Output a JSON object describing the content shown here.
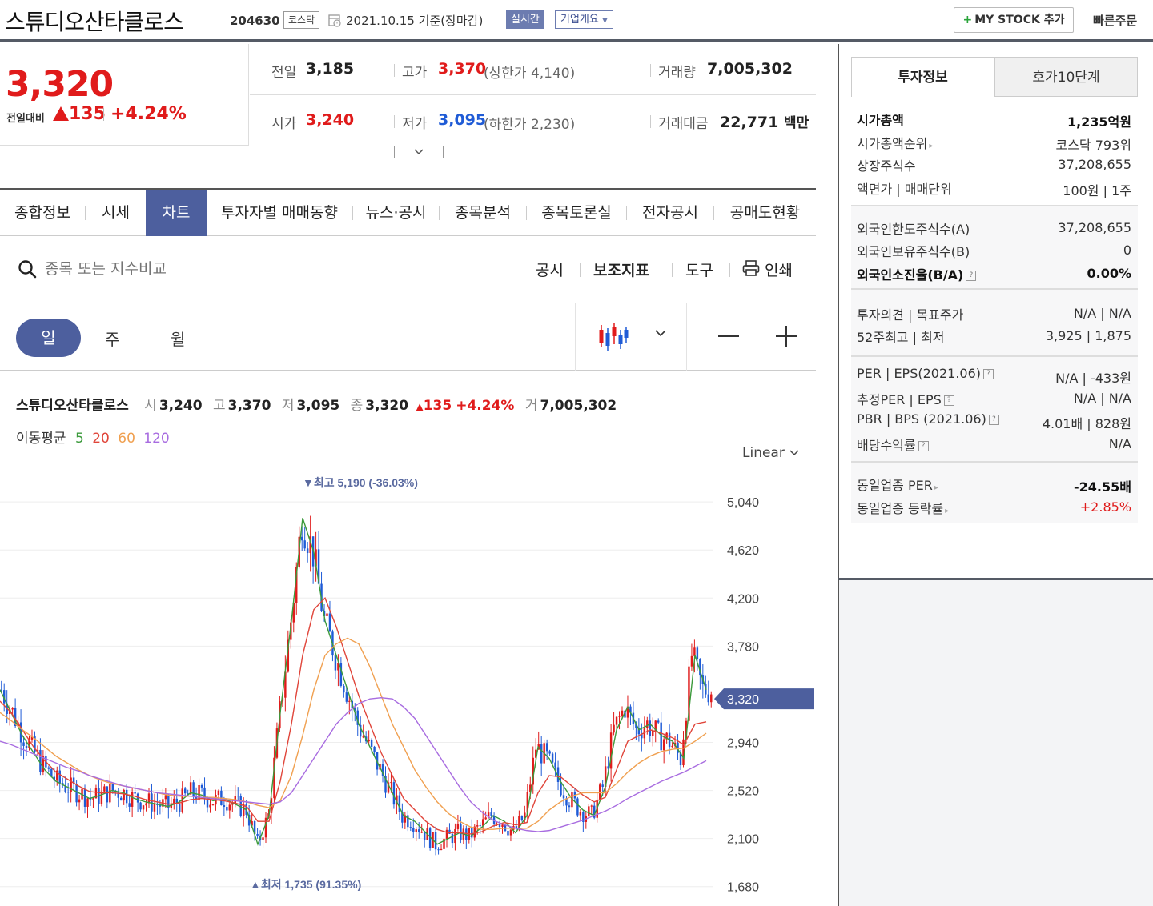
{
  "header": {
    "stock_name": "스튜디오산타클로스",
    "stock_code": "204630",
    "market": "코스닥",
    "date": "2021.10.15  기준(장마감)",
    "realtime_badge": "실시간",
    "corp_overview": "기업개요",
    "mystock_label": "MY STOCK 추가",
    "quick_order": "빠른주문"
  },
  "price": {
    "current": "3,320",
    "change_label": "전일대비",
    "change": "135",
    "change_pct": "+4.24%"
  },
  "quote": {
    "prev_label": "전일",
    "prev": "3,185",
    "high_label": "고가",
    "high": "3,370",
    "upper_limit": "(상한가 4,140)",
    "volume_label": "거래량",
    "volume": "7,005,302",
    "open_label": "시가",
    "open": "3,240",
    "low_label": "저가",
    "low": "3,095",
    "lower_limit": "(하한가 2,230)",
    "amount_label": "거래대금",
    "amount": "22,771",
    "amount_unit": "백만"
  },
  "tabs": [
    "종합정보",
    "시세",
    "차트",
    "투자자별 매매동향",
    "뉴스·공시",
    "종목분석",
    "종목토론실",
    "전자공시",
    "공매도현황"
  ],
  "active_tab": "차트",
  "chart_toolbar": {
    "search_placeholder": "종목 또는 지수비교",
    "disclosure": "공시",
    "indicators": "보조지표",
    "tools": "도구",
    "print": "인쇄",
    "periods": [
      "일",
      "주",
      "월"
    ]
  },
  "chart_info": {
    "name": "스튜디오산타클로스",
    "open_label": "시",
    "open": "3,240",
    "high_label": "고",
    "high": "3,370",
    "low_label": "저",
    "low": "3,095",
    "close_label": "종",
    "close": "3,320",
    "change": "135",
    "change_pct": "+4.24%",
    "volume_label": "거",
    "volume": "7,005,302",
    "ma_label": "이동평균",
    "ma_periods": [
      "5",
      "20",
      "60",
      "120"
    ],
    "scale": "Linear"
  },
  "colors": {
    "up": "#e01b1b",
    "down": "#1f5bd6",
    "accent": "#4d5f9e",
    "ma5": "#3c9a3c",
    "ma20": "#e0453a",
    "ma60": "#f0a050",
    "ma120": "#a86ce0"
  },
  "chart_data": {
    "type": "line",
    "title": "",
    "xlabel": "",
    "ylabel": "",
    "y_ticks": [
      1680,
      2100,
      2520,
      2940,
      3320,
      3780,
      4200,
      4620,
      5040
    ],
    "y_tick_labels": [
      "1,680",
      "2,100",
      "2,520",
      "2,940",
      "3,320",
      "3,780",
      "4,200",
      "4,620",
      "5,040"
    ],
    "ylim": [
      1580,
      5300
    ],
    "current_label": "3,320",
    "high_annotation": "최고 5,190 (-36.03%)",
    "low_annotation": "최저 1,735 (91.35%)",
    "series": [
      {
        "name": "5",
        "values": [
          3400,
          3200,
          3000,
          2850,
          2700,
          2600,
          2550,
          2500,
          2450,
          2480,
          2520,
          2500,
          2450,
          2420,
          2400,
          2380,
          2420,
          2500,
          2480,
          2430,
          2450,
          2400,
          2350,
          2050,
          2300,
          3200,
          4000,
          4900,
          4600,
          4000,
          3700,
          3400,
          3100,
          2900,
          2700,
          2500,
          2300,
          2250,
          2150,
          2050,
          2100,
          2150,
          2120,
          2200,
          2300,
          2250,
          2150,
          2300,
          2900,
          2800,
          2600,
          2450,
          2350,
          2300,
          2550,
          3050,
          3250,
          3050,
          3100,
          3000,
          2950,
          2800,
          3700,
          3400
        ]
      },
      {
        "name": "20",
        "values": [
          3300,
          3200,
          3050,
          2900,
          2780,
          2680,
          2620,
          2560,
          2510,
          2500,
          2500,
          2490,
          2470,
          2440,
          2420,
          2400,
          2410,
          2440,
          2450,
          2440,
          2430,
          2410,
          2380,
          2250,
          2250,
          2600,
          3100,
          3700,
          4100,
          4200,
          3950,
          3650,
          3350,
          3100,
          2850,
          2650,
          2450,
          2350,
          2250,
          2180,
          2150,
          2150,
          2140,
          2160,
          2210,
          2240,
          2220,
          2240,
          2500,
          2650,
          2640,
          2560,
          2480,
          2420,
          2460,
          2700,
          2950,
          3000,
          3050,
          3020,
          2980,
          2920,
          3100,
          3120
        ]
      },
      {
        "name": "60",
        "values": [
          3200,
          3130,
          3050,
          2980,
          2900,
          2820,
          2760,
          2700,
          2650,
          2610,
          2580,
          2560,
          2540,
          2520,
          2500,
          2480,
          2470,
          2470,
          2460,
          2460,
          2450,
          2440,
          2420,
          2390,
          2370,
          2430,
          2650,
          3000,
          3400,
          3700,
          3800,
          3850,
          3800,
          3600,
          3350,
          3100,
          2900,
          2700,
          2550,
          2420,
          2320,
          2250,
          2200,
          2180,
          2180,
          2190,
          2190,
          2190,
          2250,
          2350,
          2420,
          2470,
          2500,
          2500,
          2500,
          2580,
          2680,
          2760,
          2820,
          2860,
          2880,
          2890,
          2950,
          3020
        ]
      },
      {
        "name": "120",
        "values": [
          2950,
          2920,
          2880,
          2840,
          2800,
          2760,
          2720,
          2690,
          2650,
          2620,
          2590,
          2560,
          2540,
          2520,
          2500,
          2490,
          2480,
          2470,
          2460,
          2450,
          2440,
          2430,
          2420,
          2410,
          2400,
          2420,
          2500,
          2650,
          2800,
          2950,
          3100,
          3200,
          3280,
          3320,
          3330,
          3320,
          3250,
          3150,
          3000,
          2850,
          2700,
          2550,
          2420,
          2330,
          2260,
          2220,
          2190,
          2170,
          2160,
          2170,
          2200,
          2230,
          2260,
          2300,
          2340,
          2390,
          2450,
          2500,
          2550,
          2600,
          2640,
          2680,
          2730,
          2780
        ]
      }
    ]
  },
  "right_panel": {
    "tab_invest": "투자정보",
    "tab_orderbook": "호가10단계",
    "sec1": [
      {
        "k": "시가총액",
        "v": "1,235억원"
      },
      {
        "k": "시가총액순위",
        "v": "코스닥 793위"
      },
      {
        "k": "상장주식수",
        "v": "37,208,655"
      },
      {
        "k": "액면가 | 매매단위",
        "v": "100원 | 1주"
      }
    ],
    "sec2": [
      {
        "k": "외국인한도주식수(A)",
        "v": "37,208,655"
      },
      {
        "k": "외국인보유주식수(B)",
        "v": "0"
      },
      {
        "k": "외국인소진율(B/A)",
        "v": "0.00%"
      }
    ],
    "sec3": [
      {
        "k": "투자의견 | 목표주가",
        "v": "N/A | N/A"
      },
      {
        "k": "52주최고 | 최저",
        "v": "3,925 | 1,875"
      }
    ],
    "sec4": [
      {
        "k": "PER | EPS(2021.06)",
        "v": "N/A | -433원"
      },
      {
        "k": "추정PER | EPS",
        "v": "N/A | N/A"
      },
      {
        "k": "PBR | BPS (2021.06)",
        "v": "4.01배 | 828원"
      },
      {
        "k": "배당수익률",
        "v": "N/A"
      }
    ],
    "sec5": [
      {
        "k": "동일업종 PER",
        "v": "-24.55배"
      },
      {
        "k": "동일업종 등락률",
        "v": "+2.85%"
      }
    ]
  }
}
